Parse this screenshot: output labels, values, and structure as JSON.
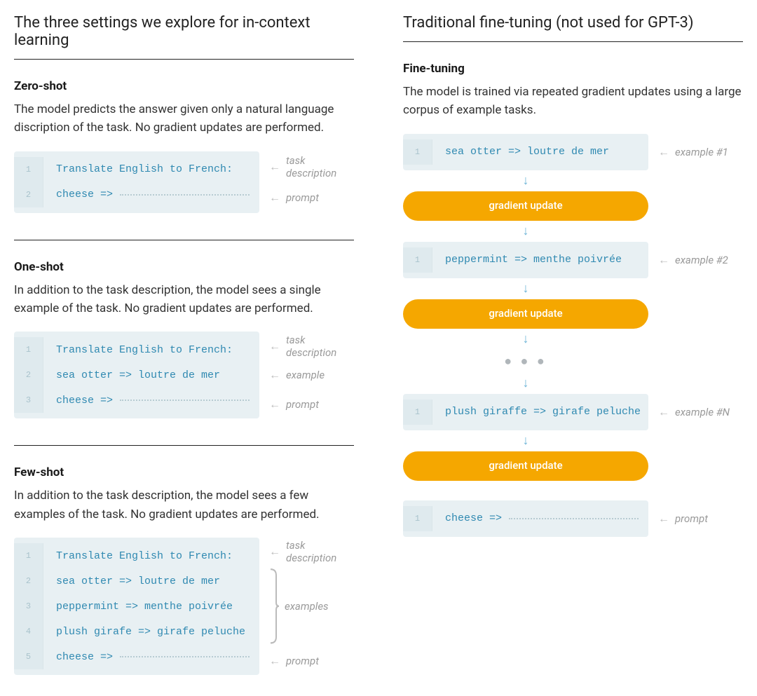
{
  "left": {
    "title": "The three settings we explore for in-context learning",
    "sections": [
      {
        "name": "Zero-shot",
        "desc": "The model predicts the answer given only a natural language discription of the task. No gradient updates are performed.",
        "rows": [
          {
            "n": "1",
            "code": "Translate English to French:",
            "annot": "task description",
            "dotted": false
          },
          {
            "n": "2",
            "code": "cheese =>",
            "annot": "prompt",
            "dotted": true
          }
        ]
      },
      {
        "name": "One-shot",
        "desc": "In addition to the task description, the model sees a single example of the task. No gradient updates are performed.",
        "rows": [
          {
            "n": "1",
            "code": "Translate English to French:",
            "annot": "task description",
            "dotted": false
          },
          {
            "n": "2",
            "code": "sea otter => loutre de mer",
            "annot": "example",
            "dotted": false
          },
          {
            "n": "3",
            "code": "cheese =>",
            "annot": "prompt",
            "dotted": true
          }
        ]
      },
      {
        "name": "Few-shot",
        "desc": "In addition to the task description, the model sees a few examples of the task. No gradient updates are performed.",
        "rows": [
          {
            "n": "1",
            "code": "Translate English to French:",
            "annot": "task description",
            "dotted": false,
            "group": null
          },
          {
            "n": "2",
            "code": "sea otter => loutre de mer",
            "annot": "examples",
            "dotted": false,
            "group": "start"
          },
          {
            "n": "3",
            "code": "peppermint => menthe poivrée",
            "annot": null,
            "dotted": false,
            "group": "mid"
          },
          {
            "n": "4",
            "code": "plush girafe => girafe peluche",
            "annot": null,
            "dotted": false,
            "group": "end"
          },
          {
            "n": "5",
            "code": "cheese =>",
            "annot": "prompt",
            "dotted": true,
            "group": null
          }
        ]
      }
    ]
  },
  "right": {
    "title": "Traditional fine-tuning (not used for GPT-3)",
    "section_name": "Fine-tuning",
    "desc": "The model is trained via repeated gradient updates using a large corpus of example tasks.",
    "items": [
      {
        "type": "code",
        "n": "1",
        "code": "sea otter => loutre de mer",
        "annot": "example #1"
      },
      {
        "type": "arrow"
      },
      {
        "type": "pill",
        "label": "gradient update"
      },
      {
        "type": "arrow"
      },
      {
        "type": "code",
        "n": "1",
        "code": "peppermint => menthe poivrée",
        "annot": "example #2"
      },
      {
        "type": "arrow"
      },
      {
        "type": "pill",
        "label": "gradient update"
      },
      {
        "type": "arrow"
      },
      {
        "type": "dots"
      },
      {
        "type": "arrow"
      },
      {
        "type": "code",
        "n": "1",
        "code": "plush giraffe => girafe peluche",
        "annot": "example #N"
      },
      {
        "type": "arrow"
      },
      {
        "type": "pill",
        "label": "gradient update"
      },
      {
        "type": "spacer"
      },
      {
        "type": "code",
        "n": "1",
        "code": "cheese =>",
        "annot": "prompt",
        "dotted": true
      }
    ]
  },
  "glyphs": {
    "left_arrow": "←",
    "down_arrow": "↓",
    "dots": "● ● ●"
  }
}
